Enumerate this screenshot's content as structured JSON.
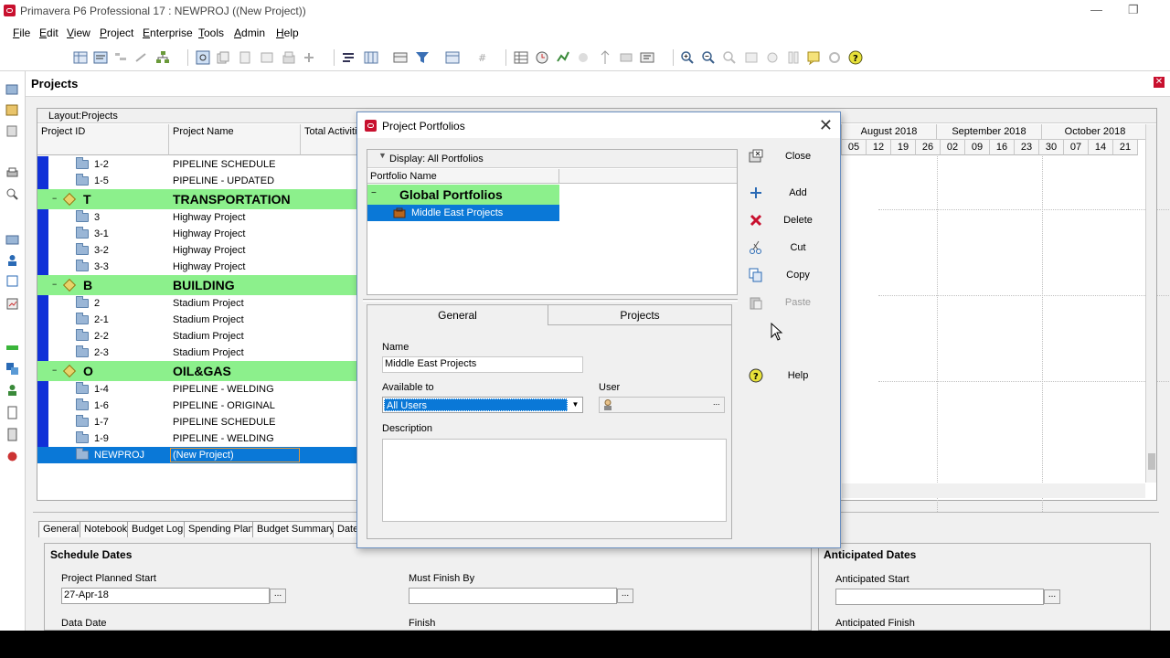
{
  "window": {
    "title": "Primavera P6 Professional 17 : NEWPROJ ((New Project))"
  },
  "menu": [
    "File",
    "Edit",
    "View",
    "Project",
    "Enterprise",
    "Tools",
    "Admin",
    "Help"
  ],
  "panel": {
    "title": "Projects",
    "layout_label": "Layout:Projects"
  },
  "columns": {
    "project_id": "Project ID",
    "project_name": "Project Name",
    "total_activities": "Total Activiti"
  },
  "gantt": {
    "months": [
      "August 2018",
      "September 2018",
      "October 2018"
    ],
    "days": [
      "05",
      "12",
      "19",
      "26",
      "02",
      "09",
      "16",
      "23",
      "30",
      "07",
      "14",
      "21"
    ]
  },
  "rows": [
    {
      "id": "1-2",
      "name": "PIPELINE SCHEDULE"
    },
    {
      "id": "1-5",
      "name": "PIPELINE - UPDATED"
    },
    {
      "group": true,
      "id": "T",
      "name": "TRANSPORTATION"
    },
    {
      "id": "3",
      "name": "Highway Project"
    },
    {
      "id": "3-1",
      "name": "Highway Project"
    },
    {
      "id": "3-2",
      "name": "Highway Project"
    },
    {
      "id": "3-3",
      "name": "Highway Project"
    },
    {
      "group": true,
      "id": "B",
      "name": "BUILDING"
    },
    {
      "id": "2",
      "name": "Stadium Project"
    },
    {
      "id": "2-1",
      "name": "Stadium Project"
    },
    {
      "id": "2-2",
      "name": "Stadium Project"
    },
    {
      "id": "2-3",
      "name": "Stadium Project"
    },
    {
      "group": true,
      "id": "O",
      "name": "OIL&GAS"
    },
    {
      "id": "1-4",
      "name": "PIPELINE - WELDING"
    },
    {
      "id": "1-6",
      "name": "PIPELINE - ORIGINAL"
    },
    {
      "id": "1-7",
      "name": "PIPELINE SCHEDULE"
    },
    {
      "id": "1-9",
      "name": "PIPELINE - WELDING"
    },
    {
      "id": "NEWPROJ",
      "name": "(New Project)",
      "selected": true
    }
  ],
  "bottom_tabs": [
    "General",
    "Notebook",
    "Budget Log",
    "Spending Plan",
    "Budget Summary",
    "Date"
  ],
  "schedule": {
    "title": "Schedule Dates",
    "planned_start_label": "Project Planned Start",
    "planned_start_value": "27-Apr-18",
    "must_finish_label": "Must Finish By",
    "must_finish_value": "",
    "data_date_label": "Data Date",
    "finish_label": "Finish"
  },
  "anticipated": {
    "title": "Anticipated Dates",
    "start_label": "Anticipated Start",
    "start_value": "",
    "finish_label": "Anticipated Finish"
  },
  "dialog": {
    "title": "Project Portfolios",
    "display_label": "Display: All Portfolios",
    "col_portfolio_name": "Portfolio Name",
    "group_name": "Global Portfolios",
    "selected_portfolio": "Middle East Projects",
    "buttons": {
      "close": "Close",
      "add": "Add",
      "delete": "Delete",
      "cut": "Cut",
      "copy": "Copy",
      "paste": "Paste",
      "help": "Help"
    },
    "tabs": {
      "general": "General",
      "projects": "Projects"
    },
    "form": {
      "name_label": "Name",
      "name_value": "Middle East Projects",
      "available_label": "Available to",
      "available_value": "All Users",
      "user_label": "User",
      "user_value": "",
      "description_label": "Description",
      "description_value": ""
    }
  },
  "colors": {
    "group_green": "#8cf08c",
    "selection_blue": "#0a78d7",
    "wbs_bar_blue": "#1030d8",
    "oracle_red": "#c8102e"
  }
}
